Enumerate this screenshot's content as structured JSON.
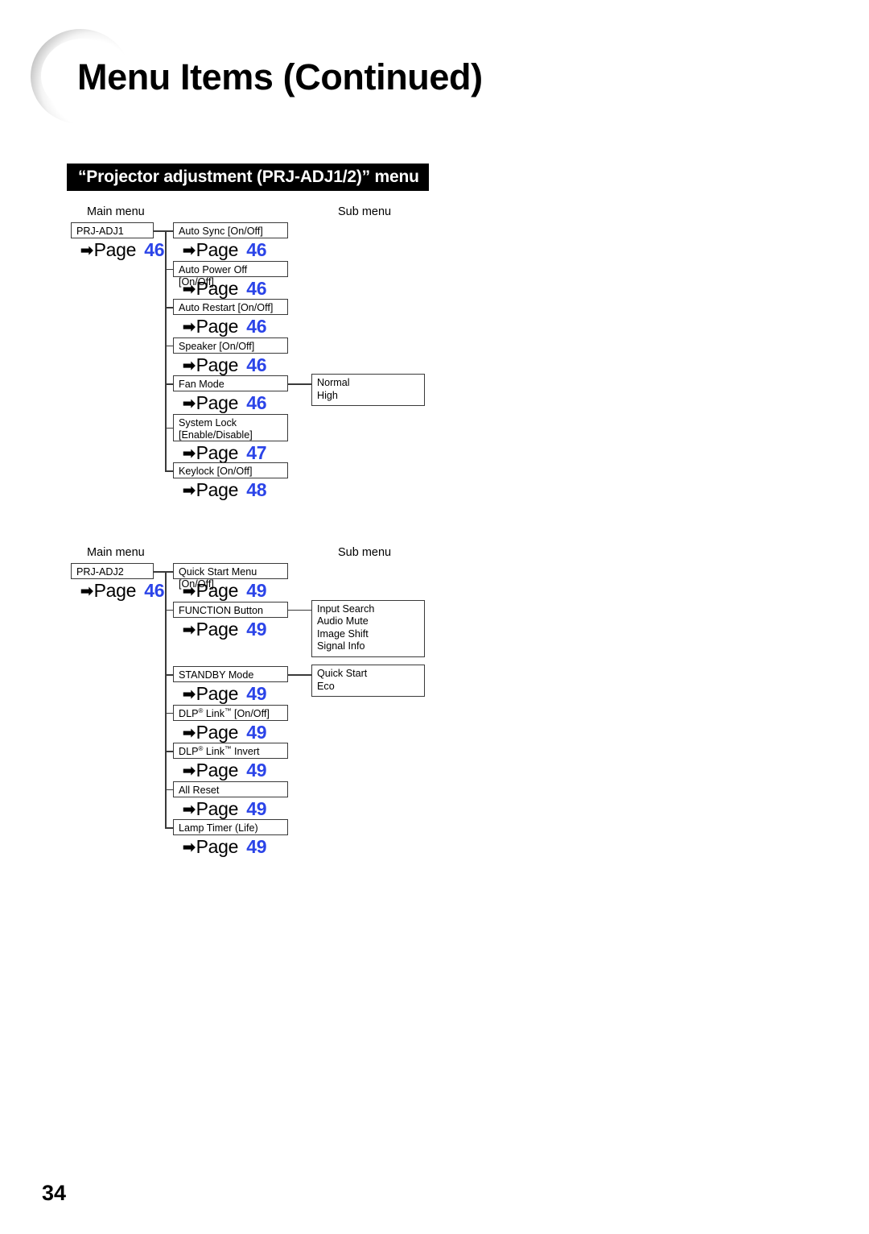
{
  "header": {
    "title": "Menu Items (Continued)",
    "orb_icon": "decorative-circle"
  },
  "section": {
    "bar_title": "“Projector adjustment (PRJ-ADJ1/2)” menu"
  },
  "footer": {
    "page_number": "34"
  },
  "colors": {
    "page_number_blue": "#2b44e8",
    "bar_background": "#000000",
    "box_border": "#3a3a3a"
  },
  "diagrams": [
    {
      "main_menu_label": "Main menu",
      "sub_menu_label": "Sub menu",
      "root": {
        "label": "PRJ-ADJ1",
        "page_prefix": "Page",
        "page": "46"
      },
      "items": [
        {
          "label": "Auto Sync [On/Off]",
          "page_prefix": "Page",
          "page": "46",
          "sub": null
        },
        {
          "label": "Auto Power Off [On/Off]",
          "page_prefix": "Page",
          "page": "46",
          "sub": null
        },
        {
          "label": "Auto Restart [On/Off]",
          "page_prefix": "Page",
          "page": "46",
          "sub": null
        },
        {
          "label": "Speaker [On/Off]",
          "page_prefix": "Page",
          "page": "46",
          "sub": null
        },
        {
          "label": "Fan Mode",
          "page_prefix": "Page",
          "page": "46",
          "sub": "Normal\nHigh"
        },
        {
          "label": "System Lock\n[Enable/Disable]",
          "page_prefix": "Page",
          "page": "47",
          "sub": null
        },
        {
          "label": "Keylock [On/Off]",
          "page_prefix": "Page",
          "page": "48",
          "sub": null
        }
      ]
    },
    {
      "main_menu_label": "Main menu",
      "sub_menu_label": "Sub menu",
      "root": {
        "label": "PRJ-ADJ2",
        "page_prefix": "Page",
        "page": "46"
      },
      "items": [
        {
          "label": "Quick Start Menu [On/Off]",
          "page_prefix": "Page",
          "page": "49",
          "sub": null
        },
        {
          "label": "FUNCTION Button",
          "page_prefix": "Page",
          "page": "49",
          "sub": "Input Search\nAudio Mute\nImage Shift\nSignal Info"
        },
        {
          "label": "STANDBY Mode",
          "page_prefix": "Page",
          "page": "49",
          "sub": "Quick Start\nEco"
        },
        {
          "label": "DLP® Link™ [On/Off]",
          "page_prefix": "Page",
          "page": "49",
          "sub": null
        },
        {
          "label": "DLP® Link™ Invert",
          "page_prefix": "Page",
          "page": "49",
          "sub": null
        },
        {
          "label": "All Reset",
          "page_prefix": "Page",
          "page": "49",
          "sub": null
        },
        {
          "label": "Lamp Timer (Life)",
          "page_prefix": "Page",
          "page": "49",
          "sub": null
        }
      ]
    }
  ]
}
